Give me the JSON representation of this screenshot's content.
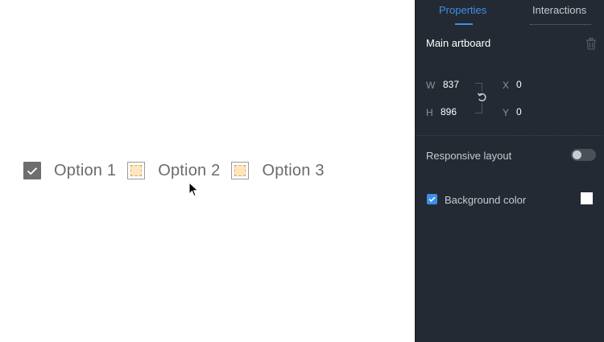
{
  "canvas": {
    "options": [
      {
        "label": "Option 1",
        "checked": true
      },
      {
        "label": "Option 2",
        "checked": false
      },
      {
        "label": "Option 3",
        "checked": false
      }
    ]
  },
  "panel": {
    "tabs": [
      {
        "label": "Properties",
        "active": true
      },
      {
        "label": "Interactions",
        "active": false
      }
    ],
    "artboard_title": "Main artboard",
    "dimensions": {
      "w_label": "W",
      "w_value": "837",
      "h_label": "H",
      "h_value": "896",
      "x_label": "X",
      "x_value": "0",
      "y_label": "Y",
      "y_value": "0"
    },
    "responsive_layout": {
      "label": "Responsive layout",
      "enabled": false
    },
    "background_color": {
      "label": "Background color",
      "checked": true,
      "color": "#ffffff"
    }
  },
  "colors": {
    "accent": "#3d8fe8",
    "panel_bg": "#242a33",
    "checkbox_checked": "#6e6e6e"
  }
}
